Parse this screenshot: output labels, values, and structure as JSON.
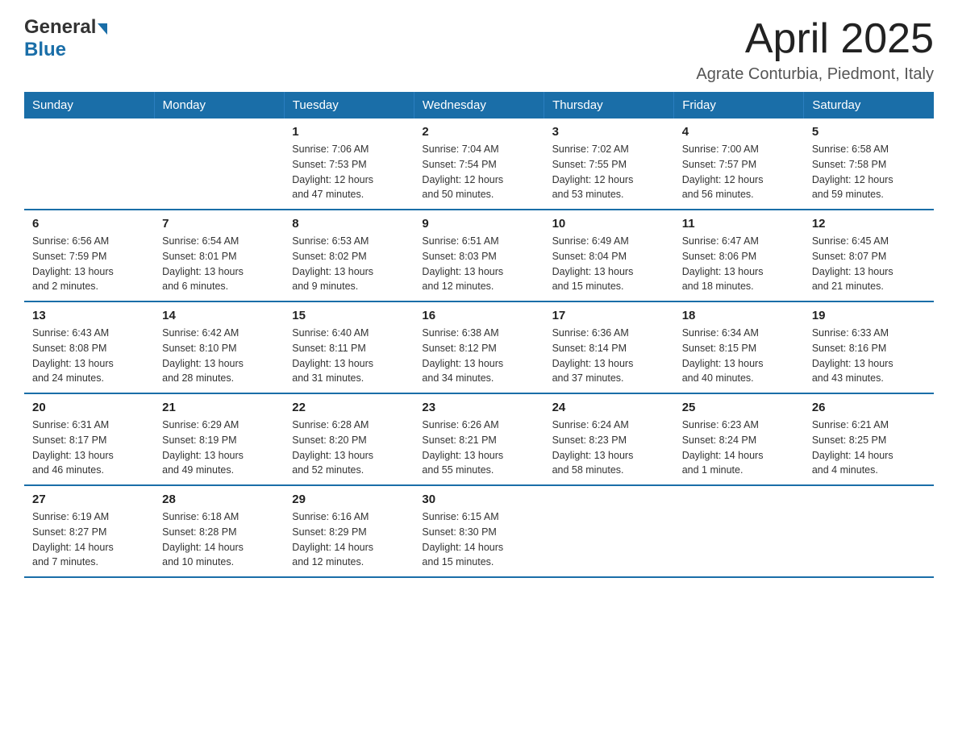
{
  "header": {
    "logo_general": "General",
    "logo_blue": "Blue",
    "month_title": "April 2025",
    "location": "Agrate Conturbia, Piedmont, Italy"
  },
  "days_of_week": [
    "Sunday",
    "Monday",
    "Tuesday",
    "Wednesday",
    "Thursday",
    "Friday",
    "Saturday"
  ],
  "weeks": [
    [
      {
        "day": "",
        "info": ""
      },
      {
        "day": "",
        "info": ""
      },
      {
        "day": "1",
        "info": "Sunrise: 7:06 AM\nSunset: 7:53 PM\nDaylight: 12 hours\nand 47 minutes."
      },
      {
        "day": "2",
        "info": "Sunrise: 7:04 AM\nSunset: 7:54 PM\nDaylight: 12 hours\nand 50 minutes."
      },
      {
        "day": "3",
        "info": "Sunrise: 7:02 AM\nSunset: 7:55 PM\nDaylight: 12 hours\nand 53 minutes."
      },
      {
        "day": "4",
        "info": "Sunrise: 7:00 AM\nSunset: 7:57 PM\nDaylight: 12 hours\nand 56 minutes."
      },
      {
        "day": "5",
        "info": "Sunrise: 6:58 AM\nSunset: 7:58 PM\nDaylight: 12 hours\nand 59 minutes."
      }
    ],
    [
      {
        "day": "6",
        "info": "Sunrise: 6:56 AM\nSunset: 7:59 PM\nDaylight: 13 hours\nand 2 minutes."
      },
      {
        "day": "7",
        "info": "Sunrise: 6:54 AM\nSunset: 8:01 PM\nDaylight: 13 hours\nand 6 minutes."
      },
      {
        "day": "8",
        "info": "Sunrise: 6:53 AM\nSunset: 8:02 PM\nDaylight: 13 hours\nand 9 minutes."
      },
      {
        "day": "9",
        "info": "Sunrise: 6:51 AM\nSunset: 8:03 PM\nDaylight: 13 hours\nand 12 minutes."
      },
      {
        "day": "10",
        "info": "Sunrise: 6:49 AM\nSunset: 8:04 PM\nDaylight: 13 hours\nand 15 minutes."
      },
      {
        "day": "11",
        "info": "Sunrise: 6:47 AM\nSunset: 8:06 PM\nDaylight: 13 hours\nand 18 minutes."
      },
      {
        "day": "12",
        "info": "Sunrise: 6:45 AM\nSunset: 8:07 PM\nDaylight: 13 hours\nand 21 minutes."
      }
    ],
    [
      {
        "day": "13",
        "info": "Sunrise: 6:43 AM\nSunset: 8:08 PM\nDaylight: 13 hours\nand 24 minutes."
      },
      {
        "day": "14",
        "info": "Sunrise: 6:42 AM\nSunset: 8:10 PM\nDaylight: 13 hours\nand 28 minutes."
      },
      {
        "day": "15",
        "info": "Sunrise: 6:40 AM\nSunset: 8:11 PM\nDaylight: 13 hours\nand 31 minutes."
      },
      {
        "day": "16",
        "info": "Sunrise: 6:38 AM\nSunset: 8:12 PM\nDaylight: 13 hours\nand 34 minutes."
      },
      {
        "day": "17",
        "info": "Sunrise: 6:36 AM\nSunset: 8:14 PM\nDaylight: 13 hours\nand 37 minutes."
      },
      {
        "day": "18",
        "info": "Sunrise: 6:34 AM\nSunset: 8:15 PM\nDaylight: 13 hours\nand 40 minutes."
      },
      {
        "day": "19",
        "info": "Sunrise: 6:33 AM\nSunset: 8:16 PM\nDaylight: 13 hours\nand 43 minutes."
      }
    ],
    [
      {
        "day": "20",
        "info": "Sunrise: 6:31 AM\nSunset: 8:17 PM\nDaylight: 13 hours\nand 46 minutes."
      },
      {
        "day": "21",
        "info": "Sunrise: 6:29 AM\nSunset: 8:19 PM\nDaylight: 13 hours\nand 49 minutes."
      },
      {
        "day": "22",
        "info": "Sunrise: 6:28 AM\nSunset: 8:20 PM\nDaylight: 13 hours\nand 52 minutes."
      },
      {
        "day": "23",
        "info": "Sunrise: 6:26 AM\nSunset: 8:21 PM\nDaylight: 13 hours\nand 55 minutes."
      },
      {
        "day": "24",
        "info": "Sunrise: 6:24 AM\nSunset: 8:23 PM\nDaylight: 13 hours\nand 58 minutes."
      },
      {
        "day": "25",
        "info": "Sunrise: 6:23 AM\nSunset: 8:24 PM\nDaylight: 14 hours\nand 1 minute."
      },
      {
        "day": "26",
        "info": "Sunrise: 6:21 AM\nSunset: 8:25 PM\nDaylight: 14 hours\nand 4 minutes."
      }
    ],
    [
      {
        "day": "27",
        "info": "Sunrise: 6:19 AM\nSunset: 8:27 PM\nDaylight: 14 hours\nand 7 minutes."
      },
      {
        "day": "28",
        "info": "Sunrise: 6:18 AM\nSunset: 8:28 PM\nDaylight: 14 hours\nand 10 minutes."
      },
      {
        "day": "29",
        "info": "Sunrise: 6:16 AM\nSunset: 8:29 PM\nDaylight: 14 hours\nand 12 minutes."
      },
      {
        "day": "30",
        "info": "Sunrise: 6:15 AM\nSunset: 8:30 PM\nDaylight: 14 hours\nand 15 minutes."
      },
      {
        "day": "",
        "info": ""
      },
      {
        "day": "",
        "info": ""
      },
      {
        "day": "",
        "info": ""
      }
    ]
  ]
}
